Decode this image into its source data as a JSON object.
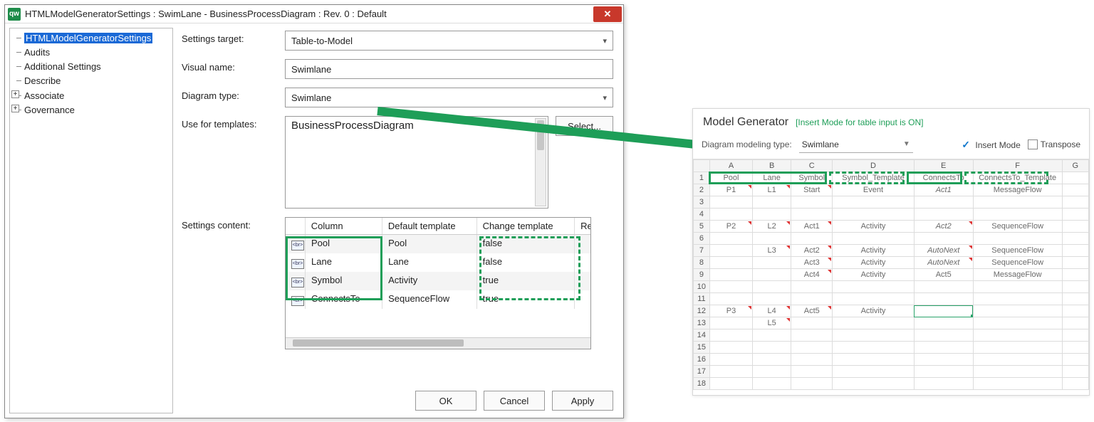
{
  "dialog": {
    "app_icon": "qw",
    "title": "HTMLModelGeneratorSettings : SwimLane - BusinessProcessDiagram : Rev. 0  : Default",
    "tree": [
      {
        "label": "HTMLModelGeneratorSettings",
        "selected": true,
        "expandable": false
      },
      {
        "label": "Audits",
        "expandable": false
      },
      {
        "label": "Additional Settings",
        "expandable": false
      },
      {
        "label": "Describe",
        "expandable": false
      },
      {
        "label": "Associate",
        "expandable": true
      },
      {
        "label": "Governance",
        "expandable": true
      }
    ],
    "labels": {
      "settings_target": "Settings target:",
      "visual_name": "Visual name:",
      "diagram_type": "Diagram type:",
      "use_for_templates": "Use for templates:",
      "settings_content": "Settings content:"
    },
    "fields": {
      "settings_target": "Table-to-Model",
      "visual_name": "Swimlane",
      "diagram_type": "Swimlane",
      "templates_list_item": "BusinessProcessDiagram",
      "select_button": "Select..."
    },
    "grid": {
      "headers": [
        "",
        "Column",
        "Default template",
        "Change template",
        "Re"
      ],
      "rows": [
        {
          "col": "Pool",
          "def": "Pool",
          "chg": "false"
        },
        {
          "col": "Lane",
          "def": "Lane",
          "chg": "false"
        },
        {
          "col": "Symbol",
          "def": "Activity",
          "chg": "true"
        },
        {
          "col": "ConnectsTo",
          "def": "SequenceFlow",
          "chg": "true"
        }
      ]
    },
    "buttons": {
      "ok": "OK",
      "cancel": "Cancel",
      "apply": "Apply"
    }
  },
  "sheet": {
    "title": "Model Generator",
    "mode": "[Insert Mode for table input is ON]",
    "toolbar": {
      "label": "Diagram modeling type:",
      "value": "Swimlane",
      "insert_mode": "Insert Mode",
      "transpose": "Transpose"
    },
    "col_headers": [
      "",
      "A",
      "B",
      "C",
      "D",
      "E",
      "F",
      "G"
    ],
    "header_row": [
      "1",
      "Pool",
      "Lane",
      "Symbol",
      "Symbol_Template",
      "ConnectsTo",
      "ConnectsTo_Template",
      ""
    ],
    "rows": [
      {
        "n": "2",
        "c": [
          "P1",
          "L1",
          "Start",
          "Event",
          "Act1",
          "MessageFlow",
          ""
        ],
        "ital": [
          4
        ],
        "mark": [
          0,
          1,
          2
        ]
      },
      {
        "n": "3",
        "c": [
          "",
          "",
          "",
          "",
          "",
          "",
          ""
        ]
      },
      {
        "n": "4",
        "c": [
          "",
          "",
          "",
          "",
          "",
          "",
          ""
        ]
      },
      {
        "n": "5",
        "c": [
          "P2",
          "L2",
          "Act1",
          "Activity",
          "Act2",
          "SequenceFlow",
          ""
        ],
        "ital": [
          4
        ],
        "mark": [
          0,
          1,
          2,
          4
        ]
      },
      {
        "n": "6",
        "c": [
          "",
          "",
          "",
          "",
          "",
          "",
          ""
        ]
      },
      {
        "n": "7",
        "c": [
          "",
          "L3",
          "Act2",
          "Activity",
          "AutoNext",
          "SequenceFlow",
          ""
        ],
        "ital": [
          4
        ],
        "mark": [
          1,
          2,
          4
        ]
      },
      {
        "n": "8",
        "c": [
          "",
          "",
          "Act3",
          "Activity",
          "AutoNext",
          "SequenceFlow",
          ""
        ],
        "ital": [
          4
        ],
        "mark": [
          2,
          4
        ]
      },
      {
        "n": "9",
        "c": [
          "",
          "",
          "Act4",
          "Activity",
          "Act5",
          "MessageFlow",
          ""
        ],
        "mark": [
          2
        ]
      },
      {
        "n": "10",
        "c": [
          "",
          "",
          "",
          "",
          "",
          "",
          ""
        ]
      },
      {
        "n": "11",
        "c": [
          "",
          "",
          "",
          "",
          "",
          "",
          ""
        ]
      },
      {
        "n": "12",
        "c": [
          "P3",
          "L4",
          "Act5",
          "Activity",
          "",
          "",
          ""
        ],
        "mark": [
          0,
          1,
          2
        ],
        "sel": 4
      },
      {
        "n": "13",
        "c": [
          "",
          "L5",
          "",
          "",
          "",
          "",
          ""
        ],
        "mark": [
          1
        ]
      },
      {
        "n": "14",
        "c": [
          "",
          "",
          "",
          "",
          "",
          "",
          ""
        ]
      },
      {
        "n": "15",
        "c": [
          "",
          "",
          "",
          "",
          "",
          "",
          ""
        ]
      },
      {
        "n": "16",
        "c": [
          "",
          "",
          "",
          "",
          "",
          "",
          ""
        ]
      },
      {
        "n": "17",
        "c": [
          "",
          "",
          "",
          "",
          "",
          "",
          ""
        ]
      },
      {
        "n": "18",
        "c": [
          "",
          "",
          "",
          "",
          "",
          "",
          ""
        ]
      }
    ]
  }
}
